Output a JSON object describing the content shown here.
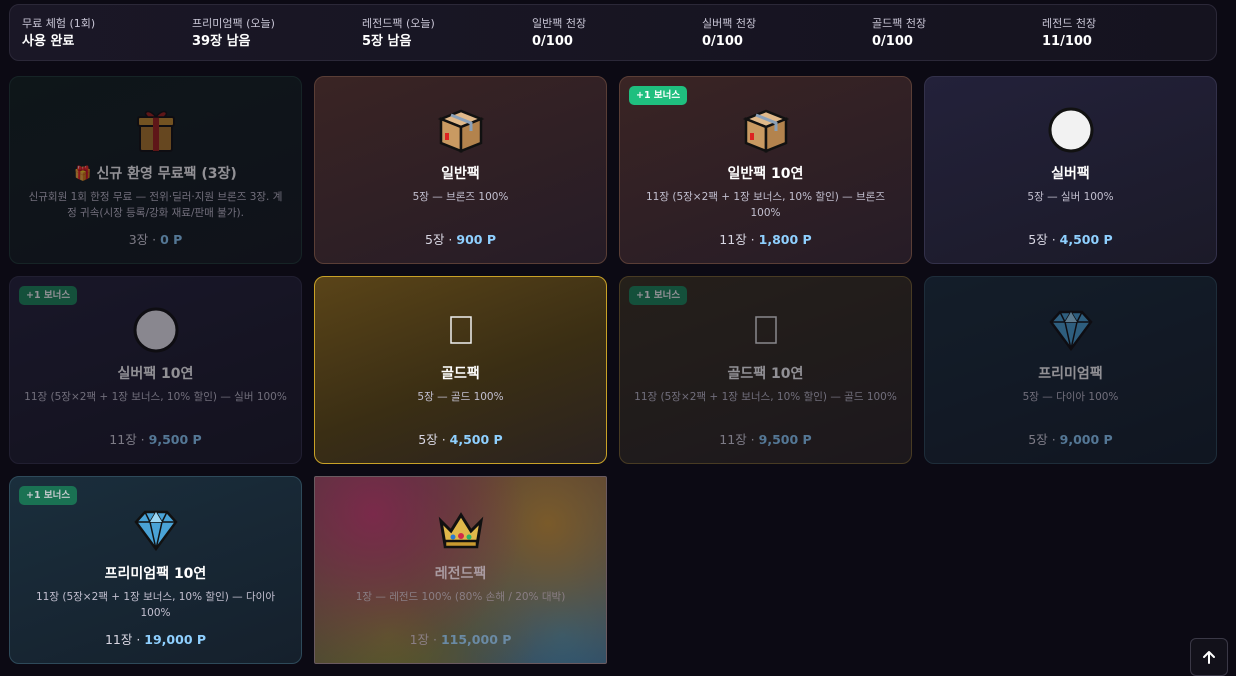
{
  "stats": [
    {
      "label": "무료 체험 (1회)",
      "value": "사용 완료"
    },
    {
      "label": "프리미엄팩 (오늘)",
      "value": "39장 남음"
    },
    {
      "label": "레전드팩 (오늘)",
      "value": "5장 남음"
    },
    {
      "label": "일반팩 천장",
      "value": "0/100"
    },
    {
      "label": "실버팩 천장",
      "value": "0/100"
    },
    {
      "label": "골드팩 천장",
      "value": "0/100"
    },
    {
      "label": "레전드 천장",
      "value": "11/100"
    }
  ],
  "packs": [
    {
      "title": "🎁 신규 환영 무료팩 (3장)",
      "desc": "신규회원 1회 한정 무료 — 전위·딜러·지원 브론즈 3장. 계정 귀속(시장 등록/강화 재료/판매 불가).",
      "count": "3장 · ",
      "price": "0 P",
      "icon": "gift-icon"
    },
    {
      "title": "일반팩",
      "desc": "5장 — 브론즈 100%",
      "count": "5장 · ",
      "price": "900 P",
      "icon": "package-icon"
    },
    {
      "title": "일반팩 10연",
      "desc": "11장 (5장×2팩 + 1장 보너스, 10% 할인) — 브론즈 100%",
      "count": "11장 · ",
      "price": "1,800 P",
      "icon": "package-icon",
      "badge": "+1 보너스"
    },
    {
      "title": "실버팩",
      "desc": "5장 — 실버 100%",
      "count": "5장 · ",
      "price": "4,500 P",
      "icon": "white-circle-icon"
    },
    {
      "title": "실버팩 10연",
      "desc": "11장 (5장×2팩 + 1장 보너스, 10% 할인) — 실버 100%",
      "count": "11장 · ",
      "price": "9,500 P",
      "icon": "silver-circle-icon",
      "badge": "+1 보너스"
    },
    {
      "title": "골드팩",
      "desc": "5장 — 골드 100%",
      "count": "5장 · ",
      "price": "4,500 P",
      "icon": "missing-glyph-icon"
    },
    {
      "title": "골드팩 10연",
      "desc": "11장 (5장×2팩 + 1장 보너스, 10% 할인) — 골드 100%",
      "count": "11장 · ",
      "price": "9,500 P",
      "icon": "missing-glyph-icon",
      "badge": "+1 보너스"
    },
    {
      "title": "프리미엄팩",
      "desc": "5장 — 다이아 100%",
      "count": "5장 · ",
      "price": "9,000 P",
      "icon": "diamond-icon"
    },
    {
      "title": "프리미엄팩 10연",
      "desc": "11장 (5장×2팩 + 1장 보너스, 10% 할인) — 다이아 100%",
      "count": "11장 · ",
      "price": "19,000 P",
      "icon": "diamond-icon",
      "badge": "+1 보너스"
    },
    {
      "title": "레전드팩",
      "desc": "1장 — 레전드 100% (80% 손해 / 20% 대박)",
      "count": "1장 · ",
      "price": "115,000 P",
      "icon": "crown-icon"
    }
  ],
  "colors": {
    "price": "#8fd0ff",
    "badge": "#1fbf7f",
    "gold_border": "#c9a227",
    "background": "#0c0a14"
  },
  "scroll_top": {
    "icon": "arrow-up-icon"
  }
}
